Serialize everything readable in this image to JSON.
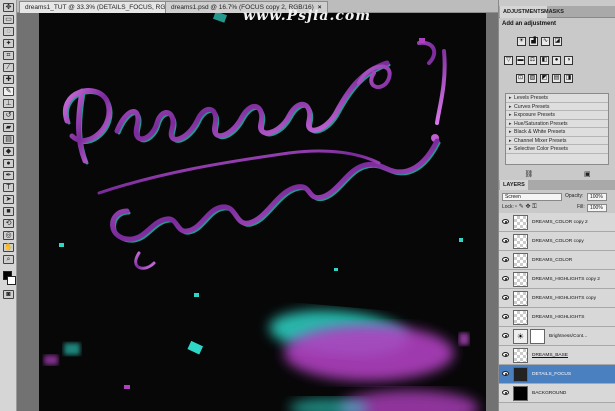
{
  "document_tabs": [
    {
      "label": "dreams1_TUT @ 33.3% (DETAILS_FOCUS, RGB/16)",
      "active": true
    },
    {
      "label": "dreams1.psd @ 16.7% (FOCUS copy 2, RGB/16)",
      "active": false
    }
  ],
  "tab_close": "×",
  "watermark": "www.Psjia.com",
  "panels": {
    "adjustments_tab": "ADJUSTMENTS",
    "masks_tab": "MASKS",
    "title": "Add an adjustment",
    "icon_rows": [
      [
        "brightness-icon",
        "levels-icon",
        "curves-icon",
        "exposure-icon"
      ],
      [
        "vibrance-icon",
        "hue-saturation-icon",
        "color-balance-icon",
        "black-white-icon",
        "photo-filter-icon",
        "channel-mixer-icon"
      ],
      [
        "invert-icon",
        "posterize-icon",
        "threshold-icon",
        "gradient-map-icon",
        "selective-color-icon"
      ]
    ],
    "presets": [
      "Levels Presets",
      "Curves Presets",
      "Exposure Presets",
      "Hue/Saturation Presets",
      "Black & White Presets",
      "Channel Mixer Presets",
      "Selective Color Presets"
    ]
  },
  "layers_panel": {
    "tab": "LAYERS",
    "blend_mode": "Screen",
    "opacity_label": "Opacity:",
    "opacity_value": "100%",
    "lock_label": "Lock:",
    "fill_label": "Fill:",
    "fill_value": "100%",
    "layers": [
      {
        "name": "DREAMS_COLOR copy 2",
        "selected": false
      },
      {
        "name": "DREAMS_COLOR copy",
        "selected": false
      },
      {
        "name": "DREAMS_COLOR",
        "selected": false
      },
      {
        "name": "DREAMS_HIGHLIGHTS copy 2",
        "selected": false
      },
      {
        "name": "DREAMS_HIGHLIGHTS copy",
        "selected": false
      },
      {
        "name": "DREAMS_HIGHLIGHTS",
        "selected": false
      },
      {
        "name": "Brightness/Cont...",
        "selected": false
      },
      {
        "name": "DREAMS_BASE",
        "selected": false
      },
      {
        "name": "DETAILS_FOCUS",
        "selected": true
      },
      {
        "name": "BACKGROUND",
        "selected": false
      }
    ]
  },
  "colors": {
    "accent_selected": "#4a7fc0",
    "magenta": "#b040c0",
    "cyan": "#2fd6c8",
    "canvas_bg": "#070708"
  }
}
